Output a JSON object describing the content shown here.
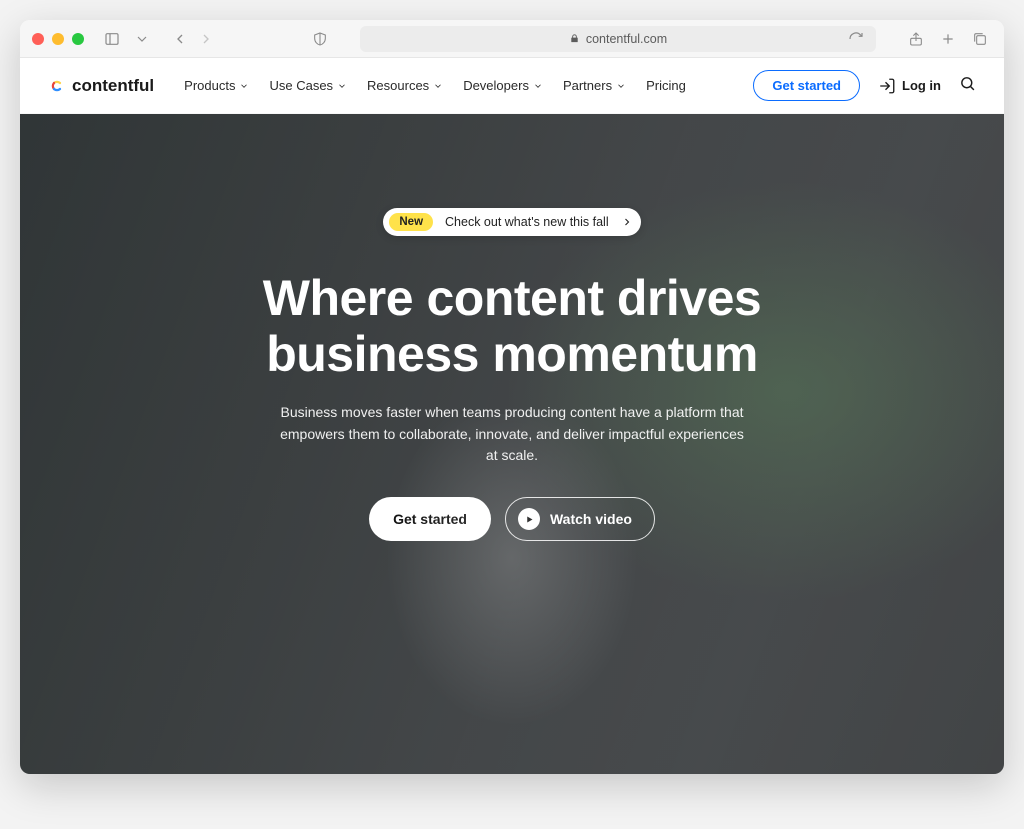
{
  "browser": {
    "url_display": "contentful.com"
  },
  "header": {
    "logo_text": "contentful",
    "nav": [
      {
        "label": "Products",
        "has_dropdown": true
      },
      {
        "label": "Use Cases",
        "has_dropdown": true
      },
      {
        "label": "Resources",
        "has_dropdown": true
      },
      {
        "label": "Developers",
        "has_dropdown": true
      },
      {
        "label": "Partners",
        "has_dropdown": true
      },
      {
        "label": "Pricing",
        "has_dropdown": false
      }
    ],
    "cta_label": "Get started",
    "login_label": "Log in"
  },
  "hero": {
    "announce_badge": "New",
    "announce_text": "Check out what's new this fall",
    "title_line1": "Where content drives",
    "title_line2": "business momentum",
    "subtitle": "Business moves faster when teams producing content have a platform that empowers them to collaborate, innovate, and deliver impactful experiences at scale.",
    "primary_cta": "Get started",
    "secondary_cta": "Watch video"
  },
  "colors": {
    "accent_blue": "#0b6cff",
    "badge_yellow": "#ffe24a"
  }
}
